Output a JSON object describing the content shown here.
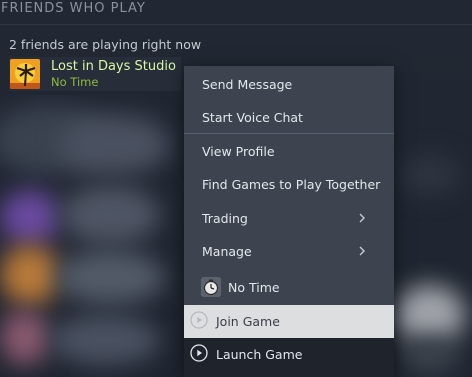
{
  "section": {
    "title": "FRIENDS WHO PLAY"
  },
  "friends_summary": "2 friends are playing right now",
  "friend": {
    "name": "Lost in Days Studio",
    "game": "No Time"
  },
  "menu": {
    "items": [
      {
        "label": "Send Message"
      },
      {
        "label": "Start Voice Chat"
      },
      {
        "label": "View Profile"
      },
      {
        "label": "Find Games to Play Together"
      },
      {
        "label": "Trading"
      },
      {
        "label": "Manage"
      },
      {
        "label": "No Time"
      },
      {
        "label": "Join Game"
      },
      {
        "label": "Launch Game"
      }
    ]
  },
  "colors": {
    "friend_name": "#d7f7a3",
    "in_game": "#8fba3f",
    "menu_bg": "#3d4450",
    "highlight": "#dcdedf"
  }
}
